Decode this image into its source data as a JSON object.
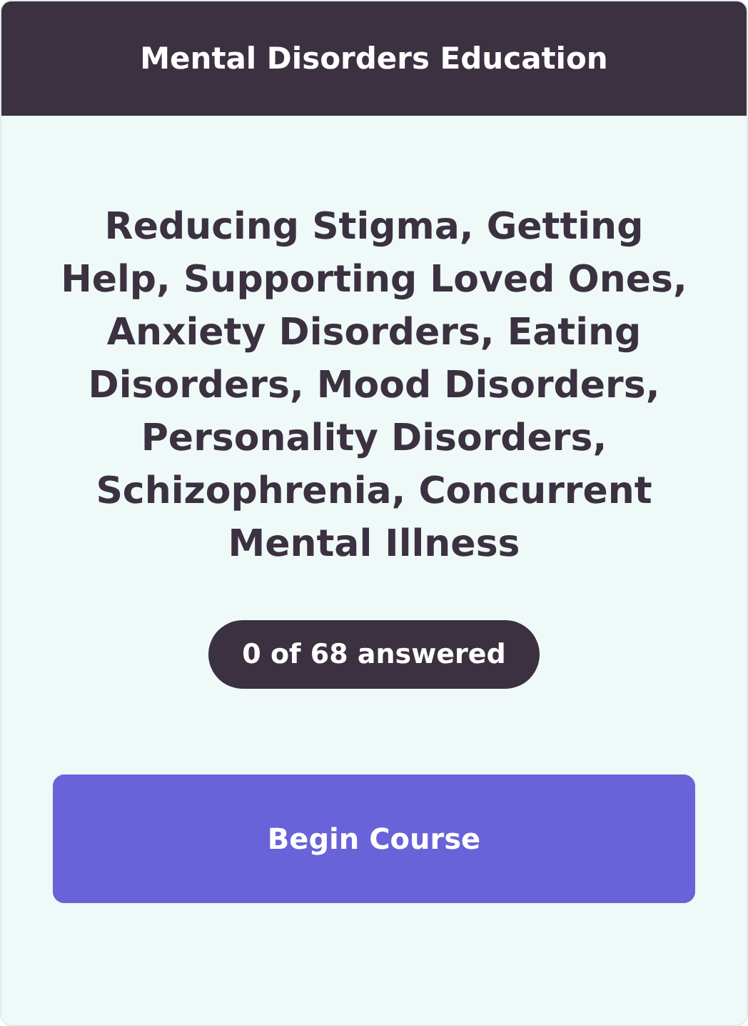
{
  "header": {
    "title": "Mental Disorders Education"
  },
  "topics": "Reducing Stigma, Getting Help, Supporting Loved Ones, Anxiety Disorders, Eating Disorders, Mood Disorders, Personality Disorders, Schizophrenia, Concurrent Mental Illness",
  "progress_badge": "0 of 68 answered",
  "action_button": "Begin Course"
}
